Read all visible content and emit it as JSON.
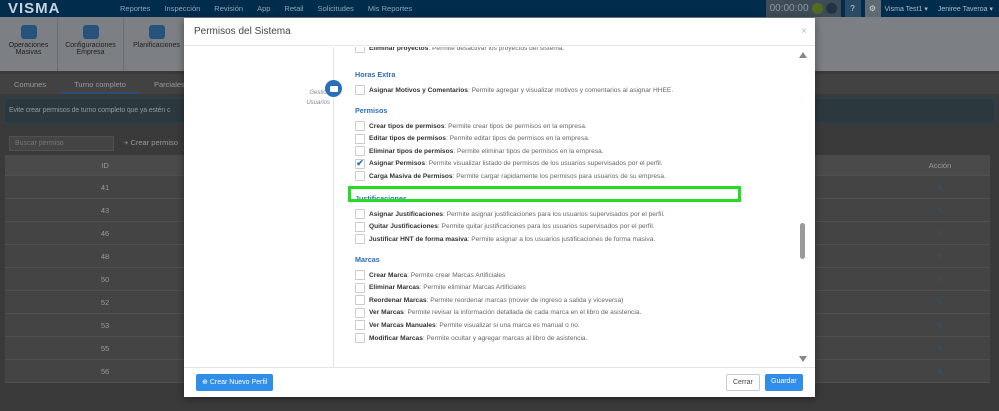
{
  "nav": {
    "logo": "VISMA",
    "items": [
      "Reportes",
      "Inspección",
      "Revisión",
      "App",
      "Retail",
      "Solicitudes",
      "Mis Reportes"
    ],
    "timer": "00:00:00",
    "company": "Visma Test1 ▾",
    "user": "Jeniree Taveroa ▾"
  },
  "toolbar": [
    {
      "label": "Operaciones Masivas"
    },
    {
      "label": "Configuraciones Empresa"
    },
    {
      "label": "Planificaciones"
    }
  ],
  "tabs": [
    "Comunes",
    "Turno completo",
    "Parciales"
  ],
  "alert": "Evite crear permisos de turno completo que ya estén c",
  "search_placeholder": "Buscar permiso",
  "create_label": "+ Crear permiso",
  "table": {
    "headers": [
      "ID",
      "Acción"
    ],
    "ids": [
      "41",
      "43",
      "46",
      "48",
      "50",
      "52",
      "53",
      "55",
      "56"
    ]
  },
  "modal": {
    "title": "Permisos del Sistema",
    "close": "×",
    "group_label": "Gestión Usuarios",
    "top_item": {
      "name": "Eliminar proyectos",
      "desc": ": Permite desactivar los proyectos del sistema.",
      "checked": false
    },
    "sections": [
      {
        "title": "Horas Extra",
        "items": [
          {
            "name": "Asignar Motivos y Comentarios",
            "desc": ": Permite agregar y visualizar motivos y comentarios al asignar HHEE.",
            "checked": false
          }
        ]
      },
      {
        "title": "Permisos",
        "items": [
          {
            "name": "Crear tipos de permisos",
            "desc": ": Permite crear tipos de permisos en la empresa.",
            "checked": false
          },
          {
            "name": "Editar tipos de permisos",
            "desc": ": Permite editar tipos de permisos en la empresa.",
            "checked": false
          },
          {
            "name": "Eliminar tipos de permisos",
            "desc": ": Permite eliminar tipos de permisos en la empresa.",
            "checked": false
          },
          {
            "name": "Asignar Permisos",
            "desc": ": Permite visualizar listado de permisos de los usuarios supervisados por el perfil.",
            "checked": true
          },
          {
            "name": "Carga Masiva de Permisos",
            "desc": ": Permite cargar rapidamente los permisos para usuarios de su empresa.",
            "checked": false
          }
        ]
      },
      {
        "title": "Justificaciones",
        "items": [
          {
            "name": "Asignar Justificaciones",
            "desc": ": Permite asignar justificaciones para los usuarios supervisados por el perfil.",
            "checked": false
          },
          {
            "name": "Quitar Justificaciones",
            "desc": ": Permite quitar justificaciones para los usuarios supervisados por el perfil.",
            "checked": false
          },
          {
            "name": "Justificar HNT de forma masiva",
            "desc": ": Permite asignar a los usuarios justificaciones de forma masiva.",
            "checked": false
          }
        ]
      },
      {
        "title": "Marcas",
        "items": [
          {
            "name": "Crear Marca",
            "desc": ": Permite crear Marcas Artificiales",
            "checked": false
          },
          {
            "name": "Eliminar Marcas",
            "desc": ": Permite eliminar Marcas Artificiales",
            "checked": false
          },
          {
            "name": "Reordenar Marcas",
            "desc": ": Permite reordenar marcas (mover de ingreso a salida y viceversa)",
            "checked": false
          },
          {
            "name": "Ver Marcas",
            "desc": ": Permite revisar la información detallada de cada marca en el libro de asistencia.",
            "checked": false
          },
          {
            "name": "Ver Marcas Manuales",
            "desc": ": Permite visualizar si una marca es manual o no.",
            "checked": false
          },
          {
            "name": "Modificar Marcas",
            "desc": ": Permite ocultar y agregar marcas al libro de asistencia.",
            "checked": false
          }
        ]
      }
    ],
    "buttons": {
      "new_profile": "Crear Nuevo Perfil",
      "close": "Cerrar",
      "save": "Guardar"
    }
  },
  "colors": {
    "accent": "#2a6ebb",
    "highlight": "#22dd22",
    "nav": "#014a80"
  }
}
